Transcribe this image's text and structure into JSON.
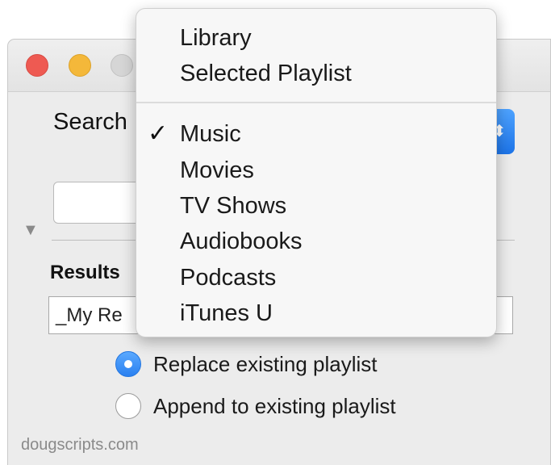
{
  "window": {
    "search_label": "Search",
    "results_label": "Results",
    "results_value": "_My Re",
    "options": [
      {
        "label": "Replace existing playlist",
        "selected": true
      },
      {
        "label": "Append to existing playlist",
        "selected": false
      }
    ],
    "footer": "dougscripts.com",
    "popup_arrow": "⬍",
    "disclosure": "▼"
  },
  "menu": {
    "group1": [
      "Library",
      "Selected Playlist"
    ],
    "group2": [
      "Music",
      "Movies",
      "TV Shows",
      "Audiobooks",
      "Podcasts",
      "iTunes U"
    ],
    "checked_item": "Music",
    "check_glyph": "✓"
  },
  "colors": {
    "accent": "#2a80f0",
    "close": "#ee5a52",
    "minimize": "#f4b83a",
    "zoom": "#d6d6d6"
  }
}
